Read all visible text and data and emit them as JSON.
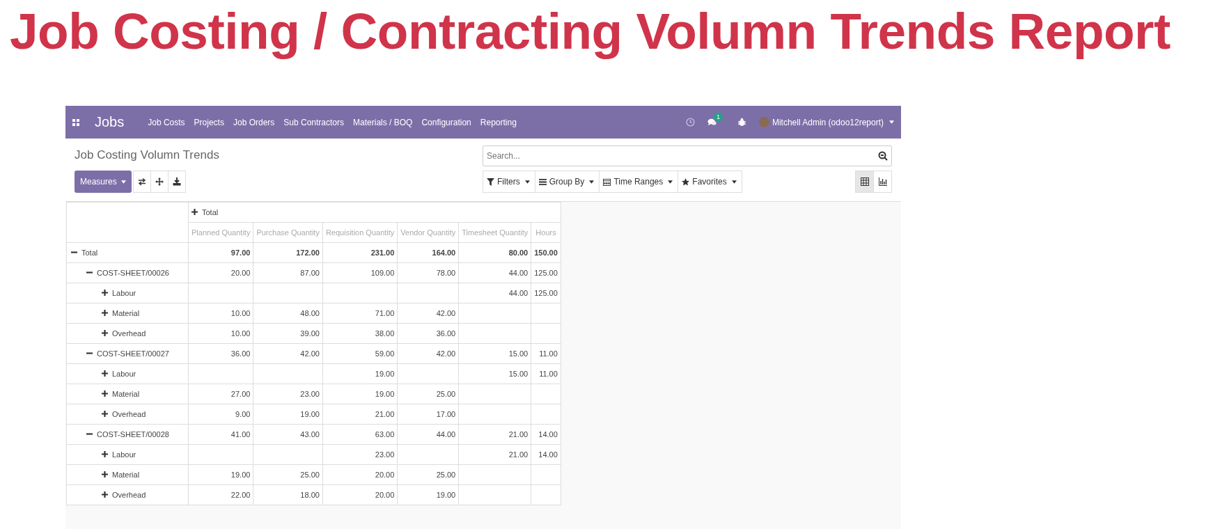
{
  "page_title": "Job Costing / Contracting Volumn Trends Report",
  "navbar": {
    "app_name": "Jobs",
    "menu": [
      "Job Costs",
      "Projects",
      "Job Orders",
      "Sub Contractors",
      "Materials / BOQ",
      "Configuration",
      "Reporting"
    ],
    "chat_badge": "1",
    "user": "Mitchell Admin (odoo12report)"
  },
  "breadcrumb": "Job Costing Volumn Trends",
  "search": {
    "placeholder": "Search..."
  },
  "measures_button": "Measures",
  "search_options": [
    "Filters",
    "Group By",
    "Time Ranges",
    "Favorites"
  ],
  "views": [
    {
      "kind": "pivot",
      "selected": true
    },
    {
      "kind": "graph",
      "selected": false
    }
  ],
  "table": {
    "column_header": {
      "label": "Total",
      "expanded": false
    },
    "columns": [
      "Planned Quantity",
      "Purchase Quantity",
      "Requisition Quantity",
      "Vendor Quantity",
      "Timesheet Quantity",
      "Hours"
    ],
    "rows": [
      {
        "label": "Total",
        "expanded": true,
        "cells": {
          "planned": "97.00",
          "purchase": "172.00",
          "requisition": "231.00",
          "vendor": "164.00",
          "timesheet": "80.00",
          "hours": "150.00"
        },
        "children": [
          {
            "label": "COST-SHEET/00026",
            "expanded": true,
            "cells": {
              "planned": "20.00",
              "purchase": "87.00",
              "requisition": "109.00",
              "vendor": "78.00",
              "timesheet": "44.00",
              "hours": "125.00"
            },
            "children": [
              {
                "label": "Labour",
                "expanded": false,
                "cells": {
                  "timesheet": "44.00",
                  "hours": "125.00"
                }
              },
              {
                "label": "Material",
                "expanded": false,
                "cells": {
                  "planned": "10.00",
                  "purchase": "48.00",
                  "requisition": "71.00",
                  "vendor": "42.00"
                }
              },
              {
                "label": "Overhead",
                "expanded": false,
                "cells": {
                  "planned": "10.00",
                  "purchase": "39.00",
                  "requisition": "38.00",
                  "vendor": "36.00"
                }
              }
            ]
          },
          {
            "label": "COST-SHEET/00027",
            "expanded": true,
            "cells": {
              "planned": "36.00",
              "purchase": "42.00",
              "requisition": "59.00",
              "vendor": "42.00",
              "timesheet": "15.00",
              "hours": "11.00"
            },
            "children": [
              {
                "label": "Labour",
                "expanded": false,
                "cells": {
                  "requisition": "19.00",
                  "timesheet": "15.00",
                  "hours": "11.00"
                }
              },
              {
                "label": "Material",
                "expanded": false,
                "cells": {
                  "planned": "27.00",
                  "purchase": "23.00",
                  "requisition": "19.00",
                  "vendor": "25.00"
                }
              },
              {
                "label": "Overhead",
                "expanded": false,
                "cells": {
                  "planned": "9.00",
                  "purchase": "19.00",
                  "requisition": "21.00",
                  "vendor": "17.00"
                }
              }
            ]
          },
          {
            "label": "COST-SHEET/00028",
            "expanded": true,
            "cells": {
              "planned": "41.00",
              "purchase": "43.00",
              "requisition": "63.00",
              "vendor": "44.00",
              "timesheet": "21.00",
              "hours": "14.00"
            },
            "children": [
              {
                "label": "Labour",
                "expanded": false,
                "cells": {
                  "requisition": "23.00",
                  "timesheet": "21.00",
                  "hours": "14.00"
                }
              },
              {
                "label": "Material",
                "expanded": false,
                "cells": {
                  "planned": "19.00",
                  "purchase": "25.00",
                  "requisition": "20.00",
                  "vendor": "25.00"
                }
              },
              {
                "label": "Overhead",
                "expanded": false,
                "cells": {
                  "planned": "22.00",
                  "purchase": "18.00",
                  "requisition": "20.00",
                  "vendor": "19.00"
                }
              }
            ]
          }
        ]
      }
    ]
  }
}
